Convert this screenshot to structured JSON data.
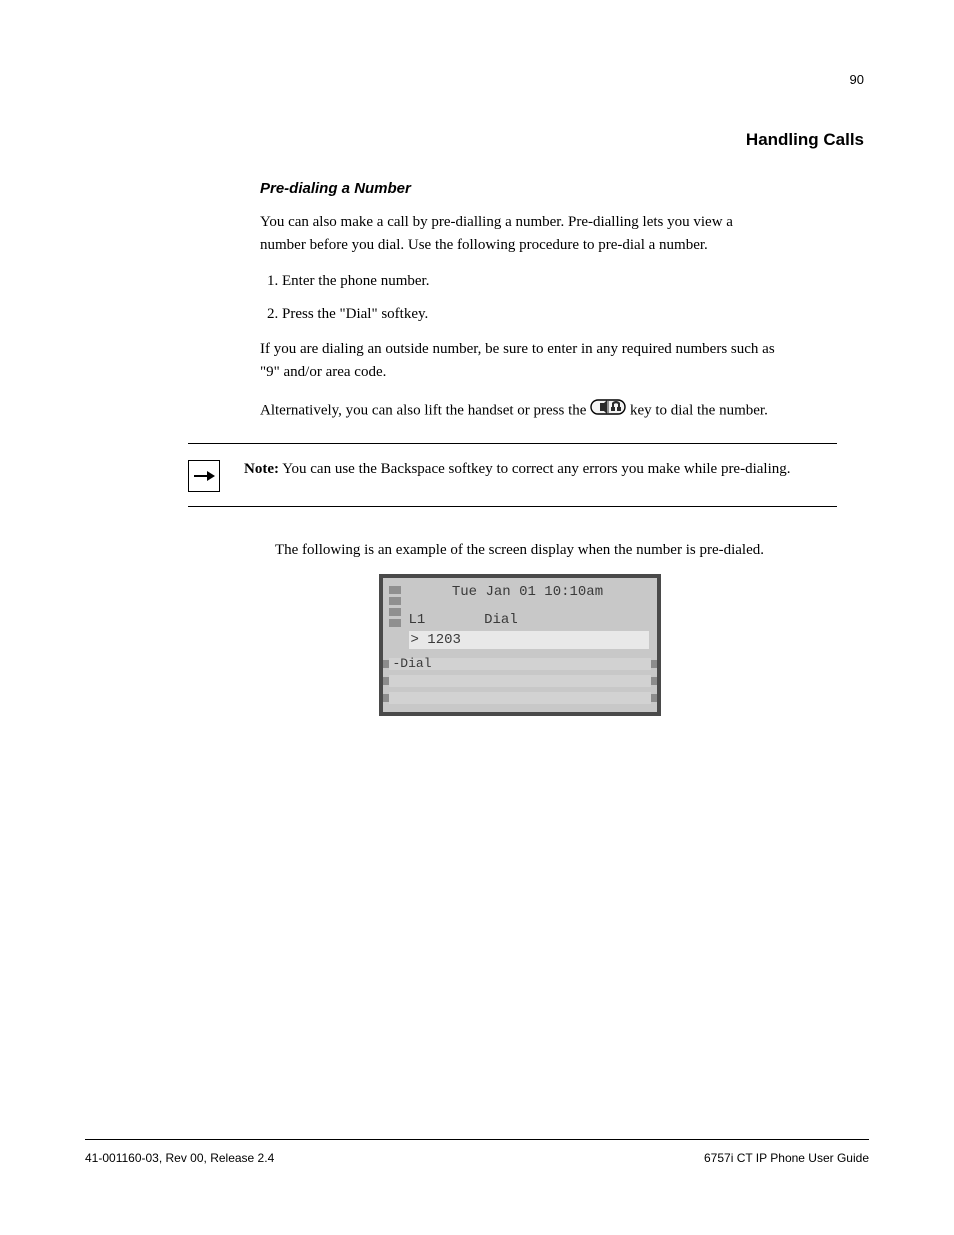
{
  "page_number_top": "90",
  "section_heading": "Handling Calls",
  "sub_heading": "Pre-dialing a Number",
  "intro": "You can also make a call by pre-dialling a number. Pre-dialling lets you view a number before you dial. Use the following procedure to pre-dial a number.",
  "steps": [
    "Enter the phone number.",
    "Press the \"Dial\" softkey."
  ],
  "alt_dial": "If you are dialing an outside number, be sure to enter in any required numbers such as \"9\" and/or area code.",
  "alt_dial_2_prefix": "Alternatively, you can also lift the handset or press the  ",
  "alt_dial_2_suffix": "  key to dial the number.",
  "note_prefix": "Note:",
  "note_body": " You can use the Backspace softkey to correct any errors you make while pre-dialing.",
  "centered_caption": "The following is an example of the screen display when the number is pre-dialed.",
  "phone": {
    "datetime": "Tue Jan 01 10:10am",
    "line_label": "L1",
    "line_status": "Dial",
    "input_text": "> 1203",
    "softkey1": "-Dial"
  },
  "footer_left": "41-001160-03, Rev 00, Release 2.4",
  "footer_right": "6757i CT IP Phone User Guide"
}
